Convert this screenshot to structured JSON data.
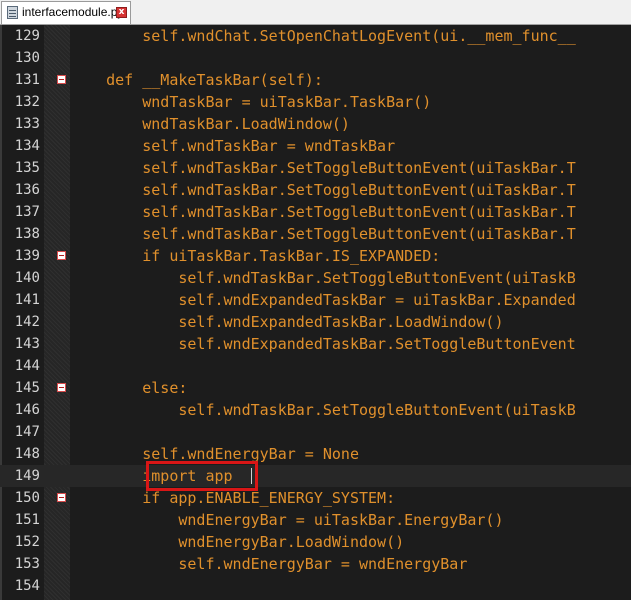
{
  "tab": {
    "filename": "interfacemodule.py",
    "close_icon": "close-icon",
    "close_glyph": "x"
  },
  "editor": {
    "colors": {
      "background": "#1c1c1c",
      "code_text": "#e0902c",
      "line_numbers": "#d4d4d4",
      "highlight_box": "#d91616",
      "fold_marker": "#d84b4b"
    },
    "lines": [
      {
        "num": "129",
        "text": "        self.wndChat.SetOpenChatLogEvent(ui.__mem_func__",
        "fold": false
      },
      {
        "num": "130",
        "text": "",
        "fold": false
      },
      {
        "num": "131",
        "text": "    def __MakeTaskBar(self):",
        "fold": true
      },
      {
        "num": "132",
        "text": "        wndTaskBar = uiTaskBar.TaskBar()",
        "fold": false
      },
      {
        "num": "133",
        "text": "        wndTaskBar.LoadWindow()",
        "fold": false
      },
      {
        "num": "134",
        "text": "        self.wndTaskBar = wndTaskBar",
        "fold": false
      },
      {
        "num": "135",
        "text": "        self.wndTaskBar.SetToggleButtonEvent(uiTaskBar.T",
        "fold": false
      },
      {
        "num": "136",
        "text": "        self.wndTaskBar.SetToggleButtonEvent(uiTaskBar.T",
        "fold": false
      },
      {
        "num": "137",
        "text": "        self.wndTaskBar.SetToggleButtonEvent(uiTaskBar.T",
        "fold": false
      },
      {
        "num": "138",
        "text": "        self.wndTaskBar.SetToggleButtonEvent(uiTaskBar.T",
        "fold": false
      },
      {
        "num": "139",
        "text": "        if uiTaskBar.TaskBar.IS_EXPANDED:",
        "fold": true
      },
      {
        "num": "140",
        "text": "            self.wndTaskBar.SetToggleButtonEvent(uiTaskB",
        "fold": false
      },
      {
        "num": "141",
        "text": "            self.wndExpandedTaskBar = uiTaskBar.Expanded",
        "fold": false
      },
      {
        "num": "142",
        "text": "            self.wndExpandedTaskBar.LoadWindow()",
        "fold": false
      },
      {
        "num": "143",
        "text": "            self.wndExpandedTaskBar.SetToggleButtonEvent",
        "fold": false
      },
      {
        "num": "144",
        "text": "",
        "fold": false
      },
      {
        "num": "145",
        "text": "        else:",
        "fold": true
      },
      {
        "num": "146",
        "text": "            self.wndTaskBar.SetToggleButtonEvent(uiTaskB",
        "fold": false
      },
      {
        "num": "147",
        "text": "",
        "fold": false
      },
      {
        "num": "148",
        "text": "        self.wndEnergyBar = None",
        "fold": false
      },
      {
        "num": "149",
        "text": "        import app",
        "fold": false
      },
      {
        "num": "150",
        "text": "        if app.ENABLE_ENERGY_SYSTEM:",
        "fold": true
      },
      {
        "num": "151",
        "text": "            wndEnergyBar = uiTaskBar.EnergyBar()",
        "fold": false
      },
      {
        "num": "152",
        "text": "            wndEnergyBar.LoadWindow()",
        "fold": false
      },
      {
        "num": "153",
        "text": "            self.wndEnergyBar = wndEnergyBar",
        "fold": false
      },
      {
        "num": "154",
        "text": "",
        "fold": false
      }
    ]
  }
}
